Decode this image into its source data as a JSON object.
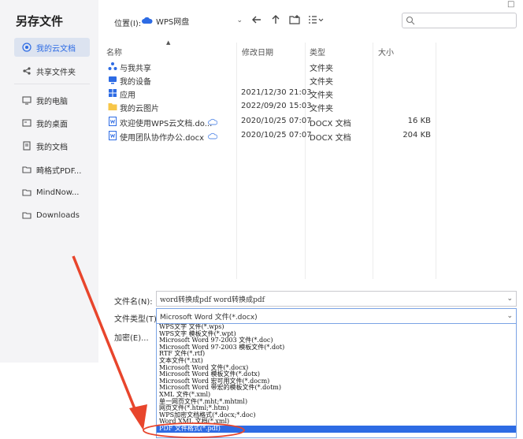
{
  "dialog": {
    "title": "另存文件",
    "close": "□"
  },
  "sidebar": {
    "items": [
      {
        "label": "我的云文档",
        "icon": "cloud-icon"
      },
      {
        "label": "共享文件夹",
        "icon": "share-icon"
      },
      {
        "label": "我的电脑",
        "icon": "computer-icon"
      },
      {
        "label": "我的桌面",
        "icon": "desktop-icon"
      },
      {
        "label": "我的文档",
        "icon": "document-icon"
      },
      {
        "label": "畸格式PDF...",
        "icon": "folder-icon"
      },
      {
        "label": "MindNow...",
        "icon": "folder-icon"
      },
      {
        "label": "Downloads",
        "icon": "folder-icon"
      }
    ]
  },
  "toolbar": {
    "location_label": "位置(I):",
    "location_value": "WPS网盘"
  },
  "columns": {
    "name": "名称",
    "modified": "修改日期",
    "type": "类型",
    "size": "大小"
  },
  "files": [
    {
      "name": "与我共享",
      "date": "",
      "type": "文件夹",
      "size": "",
      "icon": "share-folder-icon"
    },
    {
      "name": "我的设备",
      "date": "",
      "type": "文件夹",
      "size": "",
      "icon": "device-icon"
    },
    {
      "name": "应用",
      "date": "2021/12/30 21:03",
      "type": "文件夹",
      "size": "",
      "icon": "apps-icon"
    },
    {
      "name": "我的云图片",
      "date": "2022/09/20 15:03",
      "type": "文件夹",
      "size": "",
      "icon": "folder-icon"
    },
    {
      "name": "欢迎使用WPS云文档.do...",
      "date": "2020/10/25 07:07",
      "type": "DOCX 文档",
      "size": "16 KB",
      "icon": "docx-icon"
    },
    {
      "name": "使用团队协作办公.docx",
      "date": "2020/10/25 07:07",
      "type": "DOCX 文档",
      "size": "204 KB",
      "icon": "docx-icon"
    }
  ],
  "form": {
    "filename_label": "文件名(N):",
    "filename_value": "word转换成pdf word转换成pdf",
    "filetype_label": "文件类型(T):",
    "filetype_value": "Microsoft Word 文件(*.docx)",
    "encode_label": "加密(E)..."
  },
  "dropdown_options": [
    "WPS文字 文件(*.wps)",
    "WPS文字 模板文件(*.wpt)",
    "Microsoft Word 97-2003 文件(*.doc)",
    "Microsoft Word 97-2003 模板文件(*.dot)",
    "RTF 文件(*.rtf)",
    "文本文件(*.txt)",
    "Microsoft Word 文件(*.docx)",
    "Microsoft Word 模板文件(*.dotx)",
    "Microsoft Word 宏可用文件(*.docm)",
    "Microsoft Word 带宏的模板文件(*.dotm)",
    "XML 文件(*.xml)",
    "单一网页文件(*.mht;*.mhtml)",
    "网页文件(*.html;*.htm)",
    "WPS加密文档格式(*.docx;*.doc)",
    "Word XML 文档(*.xml)",
    "PDF 文件格式(*.pdf)"
  ],
  "colors": {
    "accent": "#2d6be4",
    "annotation": "#e8452c",
    "sidebar_bg": "#f4f4f6"
  }
}
